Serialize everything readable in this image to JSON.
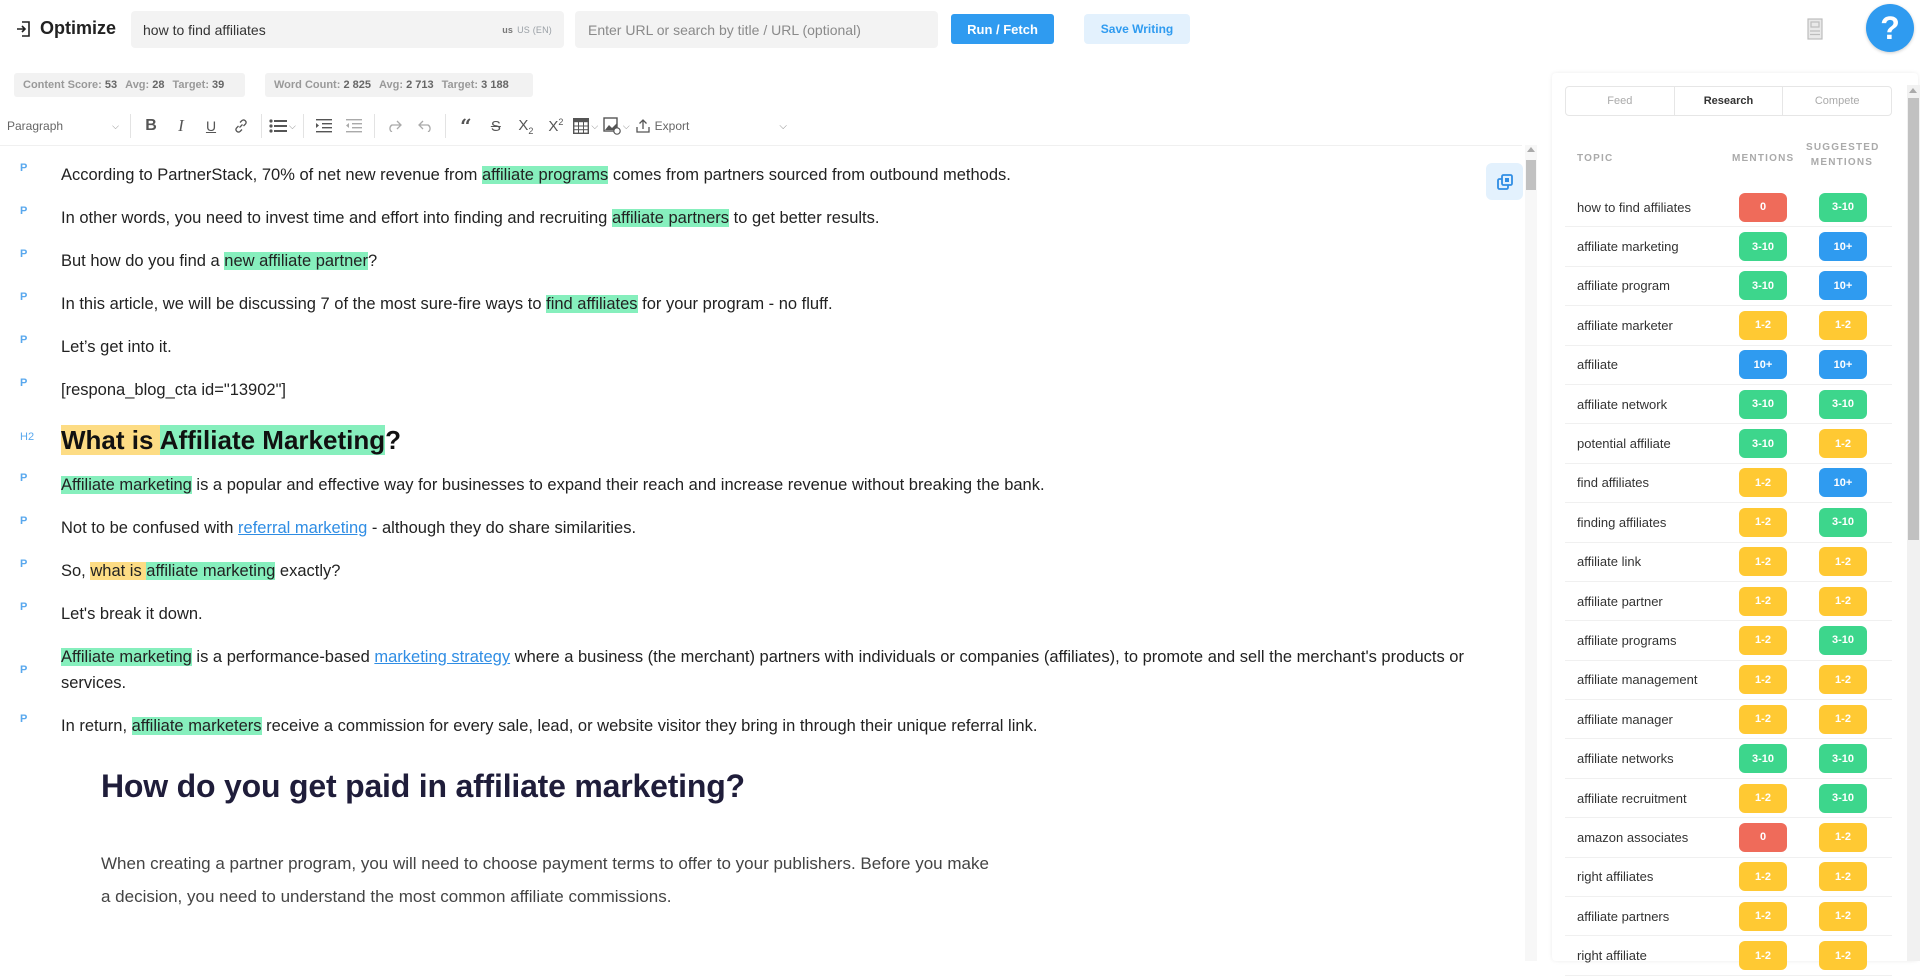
{
  "header": {
    "brand": "Optimize",
    "keyword": "how to find affiliates",
    "location_code": "us",
    "location_label": "US (EN)",
    "url_placeholder": "Enter URL or search by title / URL (optional)",
    "run_label": "Run / Fetch",
    "save_label": "Save Writing",
    "help_label": "?"
  },
  "stats": {
    "content_score_label": "Content Score:",
    "content_score": "53",
    "content_avg_label": "Avg:",
    "content_avg": "28",
    "content_target_label": "Target:",
    "content_target": "39",
    "word_count_label": "Word Count:",
    "word_count": "2 825",
    "word_avg_label": "Avg:",
    "word_avg": "2 713",
    "word_target_label": "Target:",
    "word_target": "3 188"
  },
  "toolbar": {
    "block_format": "Paragraph",
    "export_label": "Export"
  },
  "editor": {
    "blocks": [
      {
        "tag": "P",
        "parts": [
          {
            "t": "According to PartnerStack, 70% of net new revenue from "
          },
          {
            "t": "affiliate programs",
            "hl": "g"
          },
          {
            "t": " comes from partners sourced from outbound methods."
          }
        ]
      },
      {
        "tag": "P",
        "parts": [
          {
            "t": "In other words, you need to invest time and effort into finding and recruiting "
          },
          {
            "t": "affiliate partners",
            "hl": "g"
          },
          {
            "t": " to get better results."
          }
        ]
      },
      {
        "tag": "P",
        "parts": [
          {
            "t": "But how do you find a "
          },
          {
            "t": "new affiliate partner",
            "hl": "g"
          },
          {
            "t": "?"
          }
        ]
      },
      {
        "tag": "P",
        "parts": [
          {
            "t": "In this article, we will be discussing 7 of the most sure-fire ways to "
          },
          {
            "t": "find affiliates",
            "hl": "g"
          },
          {
            "t": " for your program - no fluff."
          }
        ]
      },
      {
        "tag": "P",
        "parts": [
          {
            "t": "Let’s get into it."
          }
        ]
      },
      {
        "tag": "P",
        "parts": [
          {
            "t": "[respona_blog_cta id=\"13902\"]"
          }
        ]
      },
      {
        "tag": "H2",
        "parts": [
          {
            "t": "What is ",
            "hl": "y"
          },
          {
            "t": "Affiliate Marketing",
            "hl": "g"
          },
          {
            "t": "?"
          }
        ]
      },
      {
        "tag": "P",
        "parts": [
          {
            "t": "Affiliate marketing",
            "hl": "g"
          },
          {
            "t": " is a popular and effective way for businesses to expand their reach and increase revenue without breaking the bank."
          }
        ]
      },
      {
        "tag": "P",
        "parts": [
          {
            "t": "Not to be confused with "
          },
          {
            "t": "referral marketing",
            "link": true
          },
          {
            "t": " - although they do share similarities."
          }
        ]
      },
      {
        "tag": "P",
        "parts": [
          {
            "t": "So, "
          },
          {
            "t": "what is ",
            "hl": "y"
          },
          {
            "t": "affiliate marketing",
            "hl": "g"
          },
          {
            "t": " exactly?"
          }
        ]
      },
      {
        "tag": "P",
        "parts": [
          {
            "t": "Let's break it down."
          }
        ]
      },
      {
        "tag": "P",
        "parts": [
          {
            "t": "Affiliate marketing",
            "hl": "g"
          },
          {
            "t": " is a performance-based "
          },
          {
            "t": "marketing strategy",
            "link": true
          },
          {
            "t": " where a business (the merchant) partners with individuals or companies (affiliates), to promote and sell the merchant's products or services."
          }
        ]
      },
      {
        "tag": "P",
        "parts": [
          {
            "t": "In return, "
          },
          {
            "t": "affiliate marketers",
            "hl": "g"
          },
          {
            "t": " receive a commission for every sale, lead, or website visitor they bring in through their unique referral link."
          }
        ]
      }
    ],
    "image_heading": "How do you get paid in affiliate marketing?",
    "image_paragraph": "When creating a partner program, you will need to choose payment terms to offer to your publishers. Before you make a decision, you need to understand the most common affiliate commissions."
  },
  "panel": {
    "tabs": [
      {
        "label": "Feed",
        "active": false
      },
      {
        "label": "Research",
        "active": true
      },
      {
        "label": "Compete",
        "active": false
      }
    ],
    "columns": {
      "topic": "TOPIC",
      "mentions": "MENTIONS",
      "suggested_line1": "SUGGESTED",
      "suggested_line2": "MENTIONS"
    },
    "badge_colors": {
      "red": "#ef6b5a",
      "green": "#3dd68c",
      "blue": "#2f9bf0",
      "yellow": "#ffc933"
    },
    "rows": [
      {
        "topic": "how to find affiliates",
        "mentions": "0",
        "mentions_color": "red",
        "suggested": "3-10",
        "suggested_color": "green"
      },
      {
        "topic": "affiliate marketing",
        "mentions": "3-10",
        "mentions_color": "green",
        "suggested": "10+",
        "suggested_color": "blue"
      },
      {
        "topic": "affiliate program",
        "mentions": "3-10",
        "mentions_color": "green",
        "suggested": "10+",
        "suggested_color": "blue"
      },
      {
        "topic": "affiliate marketer",
        "mentions": "1-2",
        "mentions_color": "yellow",
        "suggested": "1-2",
        "suggested_color": "yellow"
      },
      {
        "topic": "affiliate",
        "mentions": "10+",
        "mentions_color": "blue",
        "suggested": "10+",
        "suggested_color": "blue"
      },
      {
        "topic": "affiliate network",
        "mentions": "3-10",
        "mentions_color": "green",
        "suggested": "3-10",
        "suggested_color": "green"
      },
      {
        "topic": "potential affiliate",
        "mentions": "3-10",
        "mentions_color": "green",
        "suggested": "1-2",
        "suggested_color": "yellow"
      },
      {
        "topic": "find affiliates",
        "mentions": "1-2",
        "mentions_color": "yellow",
        "suggested": "10+",
        "suggested_color": "blue"
      },
      {
        "topic": "finding affiliates",
        "mentions": "1-2",
        "mentions_color": "yellow",
        "suggested": "3-10",
        "suggested_color": "green"
      },
      {
        "topic": "affiliate link",
        "mentions": "1-2",
        "mentions_color": "yellow",
        "suggested": "1-2",
        "suggested_color": "yellow"
      },
      {
        "topic": "affiliate partner",
        "mentions": "1-2",
        "mentions_color": "yellow",
        "suggested": "1-2",
        "suggested_color": "yellow"
      },
      {
        "topic": "affiliate programs",
        "mentions": "1-2",
        "mentions_color": "yellow",
        "suggested": "3-10",
        "suggested_color": "green"
      },
      {
        "topic": "affiliate management",
        "mentions": "1-2",
        "mentions_color": "yellow",
        "suggested": "1-2",
        "suggested_color": "yellow"
      },
      {
        "topic": "affiliate manager",
        "mentions": "1-2",
        "mentions_color": "yellow",
        "suggested": "1-2",
        "suggested_color": "yellow"
      },
      {
        "topic": "affiliate networks",
        "mentions": "3-10",
        "mentions_color": "green",
        "suggested": "3-10",
        "suggested_color": "green"
      },
      {
        "topic": "affiliate recruitment",
        "mentions": "1-2",
        "mentions_color": "yellow",
        "suggested": "3-10",
        "suggested_color": "green"
      },
      {
        "topic": "amazon associates",
        "mentions": "0",
        "mentions_color": "red",
        "suggested": "1-2",
        "suggested_color": "yellow"
      },
      {
        "topic": "right affiliates",
        "mentions": "1-2",
        "mentions_color": "yellow",
        "suggested": "1-2",
        "suggested_color": "yellow"
      },
      {
        "topic": "affiliate partners",
        "mentions": "1-2",
        "mentions_color": "yellow",
        "suggested": "1-2",
        "suggested_color": "yellow"
      },
      {
        "topic": "right affiliate",
        "mentions": "1-2",
        "mentions_color": "yellow",
        "suggested": "1-2",
        "suggested_color": "yellow"
      }
    ]
  }
}
